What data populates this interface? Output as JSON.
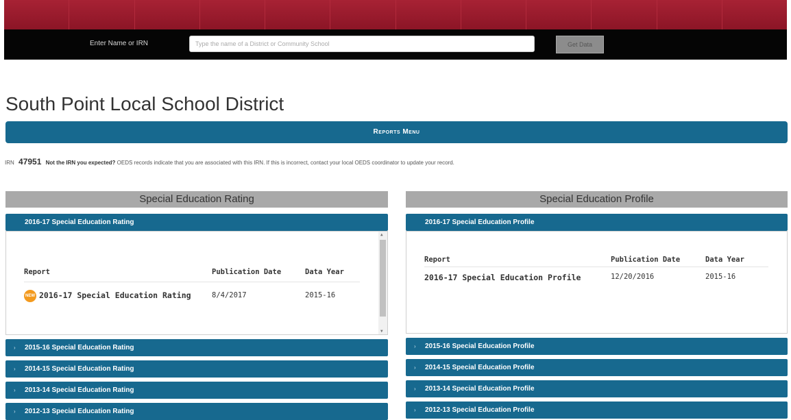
{
  "search": {
    "label": "Enter Name or IRN",
    "placeholder": "Type the name of a District or Community School",
    "button": "Get Data"
  },
  "page": {
    "title": "South Point Local School District",
    "reports_menu": "Reports Menu",
    "irn_label": "IRN",
    "irn": "47951",
    "irn_question": "Not the IRN you expected?",
    "irn_note": "OEDS records indicate that you are associated with this IRN. If this is incorrect, contact your local OEDS coordinator to update your record."
  },
  "left": {
    "header": "Special Education Rating",
    "open_panel": "2016-17 Special Education Rating",
    "columns": [
      "Report",
      "Publication Date",
      "Data Year"
    ],
    "row": {
      "badge": "NEW",
      "report": "2016-17 Special Education Rating",
      "publication_date": "8/4/2017",
      "data_year": "2015-16"
    },
    "panels": [
      "2015-16 Special Education Rating",
      "2014-15 Special Education Rating",
      "2013-14 Special Education Rating",
      "2012-13 Special Education Rating"
    ]
  },
  "right": {
    "header": "Special Education Profile",
    "open_panel": "2016-17 Special Education Profile",
    "columns": [
      "Report",
      "Publication Date",
      "Data Year"
    ],
    "row": {
      "report": "2016-17 Special Education Profile",
      "publication_date": "12/20/2016",
      "data_year": "2015-16"
    },
    "panels": [
      "2015-16 Special Education Profile",
      "2014-15 Special Education Profile",
      "2013-14 Special Education Profile",
      "2012-13 Special Education Profile"
    ]
  },
  "icons": {
    "collapsed": "chevron-right-icon",
    "new": "new-badge-icon"
  },
  "colors": {
    "brand_red": "#9a1b2c",
    "accent_blue": "#17698f",
    "header_gray": "#a9a9a9"
  }
}
